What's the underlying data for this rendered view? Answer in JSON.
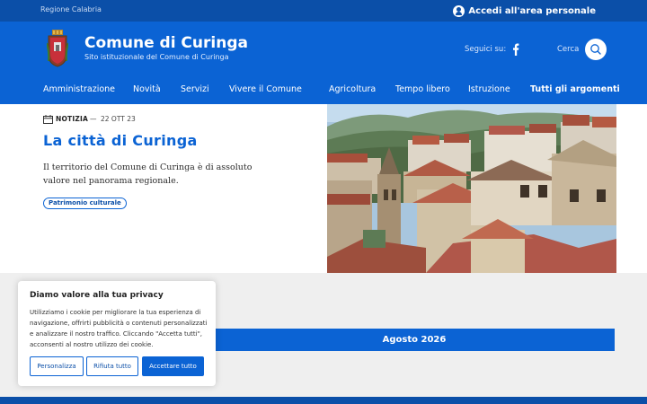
{
  "topbar": {
    "region": "Regione Calabria",
    "login_label": "Accedi all'area personale"
  },
  "header": {
    "title": "Comune di Curinga",
    "subtitle": "Sito istituzionale del Comune di Curinga",
    "follow_label": "Seguici su:",
    "search_label": "Cerca"
  },
  "nav": {
    "items": [
      "Amministrazione",
      "Novità",
      "Servizi",
      "Vivere il Comune",
      "Agricoltura",
      "Tempo libero",
      "Istruzione",
      "Tutti gli argomenti"
    ]
  },
  "news": {
    "tag": "NOTIZIA",
    "separator": "—",
    "date": "22 OTT 23",
    "headline": "La città di Curinga",
    "description": "Il territorio del Comune di Curinga è di assoluto valore nel panorama regionale.",
    "badge": "Patrimonio culturale"
  },
  "calendar": {
    "month": "Agosto 2026"
  },
  "cookie": {
    "title": "Diamo valore alla tua privacy",
    "text": "Utilizziamo i cookie per migliorare la tua esperienza di navigazione, offrirti pubblicità o contenuti personalizzati e analizzare il nostro traffico. Cliccando \"Accetta tutti\", acconsenti al nostro utilizzo dei cookie.",
    "btn_customize": "Personalizza",
    "btn_reject": "Rifiuta tutto",
    "btn_accept": "Accettare tutto"
  },
  "colors": {
    "primary": "#0b63d4",
    "topbar": "#0b4fa8"
  },
  "icons": [
    "user-icon",
    "crest-icon",
    "facebook-icon",
    "search-icon",
    "calendar-icon"
  ]
}
